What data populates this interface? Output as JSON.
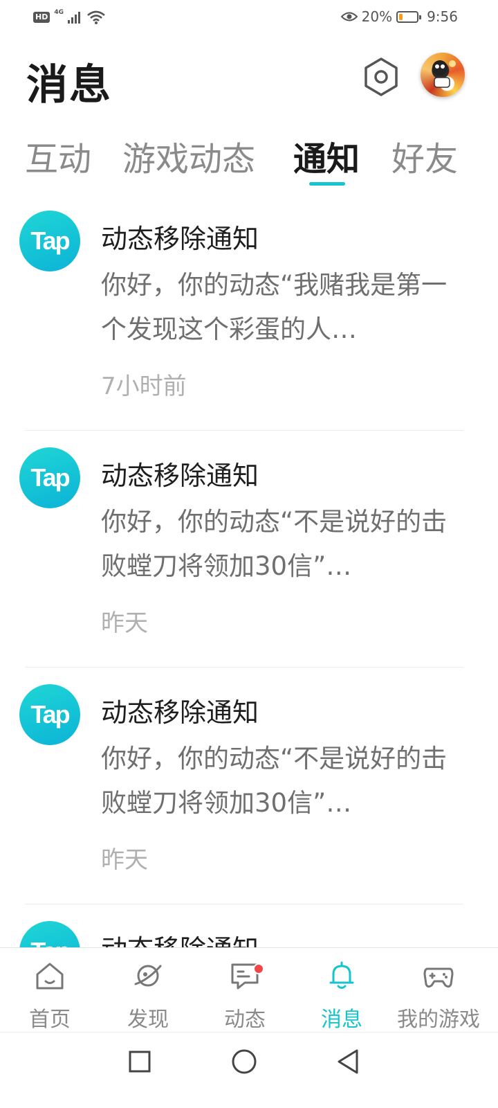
{
  "status_bar": {
    "hd_label": "HD",
    "network_label": "4G",
    "battery_percent": "20%",
    "battery_level": 0.2,
    "battery_color": "#ff9a1a",
    "time": "9:56",
    "icons": [
      "signal-icon",
      "wifi-icon",
      "eye-icon",
      "battery-icon"
    ]
  },
  "header": {
    "title": "消息",
    "settings_icon": "settings-hexagon-icon",
    "avatar_icon": "avatar"
  },
  "tabs": {
    "items": [
      {
        "label": "互动"
      },
      {
        "label": "游戏动态"
      },
      {
        "label": "通知"
      },
      {
        "label": "好友"
      }
    ],
    "active_index": 2,
    "accent_color": "#15c5ce"
  },
  "notifications": {
    "items": [
      {
        "logo_text": "Tap",
        "title": "动态移除通知",
        "body": "你好，你的动态“我赌我是第一个发现这个彩蛋的人…",
        "time": "7小时前"
      },
      {
        "logo_text": "Tap",
        "title": "动态移除通知",
        "body": "你好，你的动态“不是说好的击败螳刀将领加30信”…",
        "time": "昨天"
      },
      {
        "logo_text": "Tap",
        "title": "动态移除通知",
        "body": "你好，你的动态“不是说好的击败螳刀将领加30信”…",
        "time": "昨天"
      },
      {
        "logo_text": "Tap",
        "title": "动态移除通知",
        "body": "",
        "time": ""
      }
    ]
  },
  "bottom_nav": {
    "items": [
      {
        "label": "首页",
        "icon": "home-icon"
      },
      {
        "label": "发现",
        "icon": "planet-icon"
      },
      {
        "label": "动态",
        "icon": "chat-icon",
        "has_badge": true
      },
      {
        "label": "消息",
        "icon": "bell-icon"
      },
      {
        "label": "我的游戏",
        "icon": "gamepad-icon"
      }
    ],
    "active_index": 3,
    "badge_color": "#f04848"
  },
  "system_nav": {
    "icons": [
      "recent-apps-icon",
      "home-circle-icon",
      "back-triangle-icon"
    ]
  }
}
